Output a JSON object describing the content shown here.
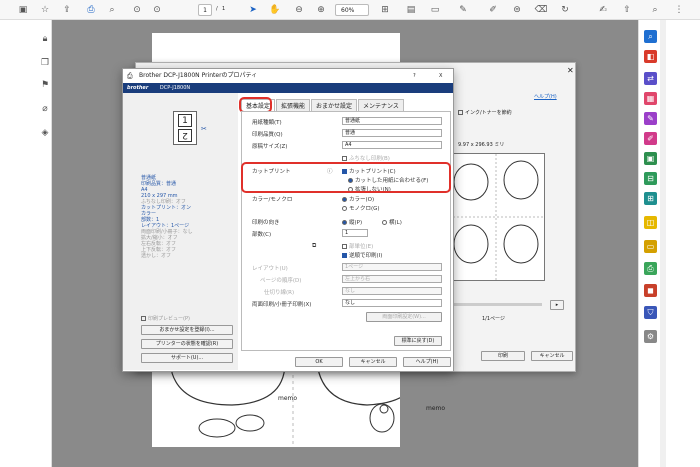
{
  "toolbar": {
    "page_current": "1",
    "page_sep": "/",
    "page_total": "1",
    "zoom": "60%"
  },
  "print_dialog": {
    "help_link": "ヘルプ(H)",
    "ink_saver": "インク/トナーを節約",
    "paper_size": "9.97 x 296.93 ミリ",
    "page_indicator": "1/1ページ",
    "print_button": "印刷",
    "cancel_button": "キャンセル"
  },
  "props": {
    "window_title": "Brother DCP-J1800N Printerのプロパティ",
    "help_q": "?",
    "close": "X",
    "brand": "brother",
    "model": "DCP-J1800N",
    "tabs": [
      "基本設定",
      "拡張機能",
      "おまかせ設定",
      "メンテナンス"
    ],
    "info_lines": [
      "普通紙",
      "印刷品質：普通",
      "A4",
      "210 x 297 mm",
      "ふちなし印刷：オフ",
      "カットプリント：オン",
      "カラー",
      "部数：1",
      "レイアウト：1ページ",
      "両面印刷/小冊子：なし",
      "",
      "拡大/縮小：オフ",
      "左右反転：オフ",
      "上下反転：オフ",
      "透かし：オフ"
    ],
    "preview_check": "印刷プレビュー(P)",
    "register_btn": "おまかせ設定を登録(I)...",
    "status_btn": "プリンターの状態を確認(R)",
    "support_btn": "サポート(U)...",
    "media_label": "用紙種類(T)",
    "media_value": "普通紙",
    "quality_label": "印刷品質(Q)",
    "quality_value": "普通",
    "size_label": "原稿サイズ(Z)",
    "size_value": "A4",
    "borderless": "ふちなし印刷(B)",
    "cut_label": "カットプリント",
    "cut_checkbox": "カットプリント(C)",
    "cut_opt1": "カットした用紙に合わせる(F)",
    "cut_opt2": "拡張しない(N)",
    "color_label": "カラー/モノクロ",
    "color_opt": "カラー(O)",
    "mono_opt": "モノクロ(G)",
    "orient_label": "印刷の向き",
    "portrait": "縦(P)",
    "landscape": "横(L)",
    "copies_label": "部数(C)",
    "copies_value": "1",
    "collate": "部単位(E)",
    "reverse": "逆順で印刷(I)",
    "layout_label": "レイアウト(U)",
    "layout_value": "1ページ",
    "order_label": "ページの順序(D)",
    "order_value": "左上から右",
    "border_label": "仕切り線(R)",
    "border_value": "なし",
    "duplex_label": "両面印刷/小冊子印刷(X)",
    "duplex_value": "なし",
    "duplex_btn": "両面印刷設定(W)...",
    "default_btn": "標準に戻す(D)",
    "ok": "OK",
    "cancel": "キャンセル",
    "help": "ヘルプ(H)"
  },
  "doc_text": {
    "memo1": "memo",
    "memo2": "memo"
  },
  "colors": {
    "accent_red": "#e0302a",
    "brand_blue": "#1a3d7c"
  }
}
